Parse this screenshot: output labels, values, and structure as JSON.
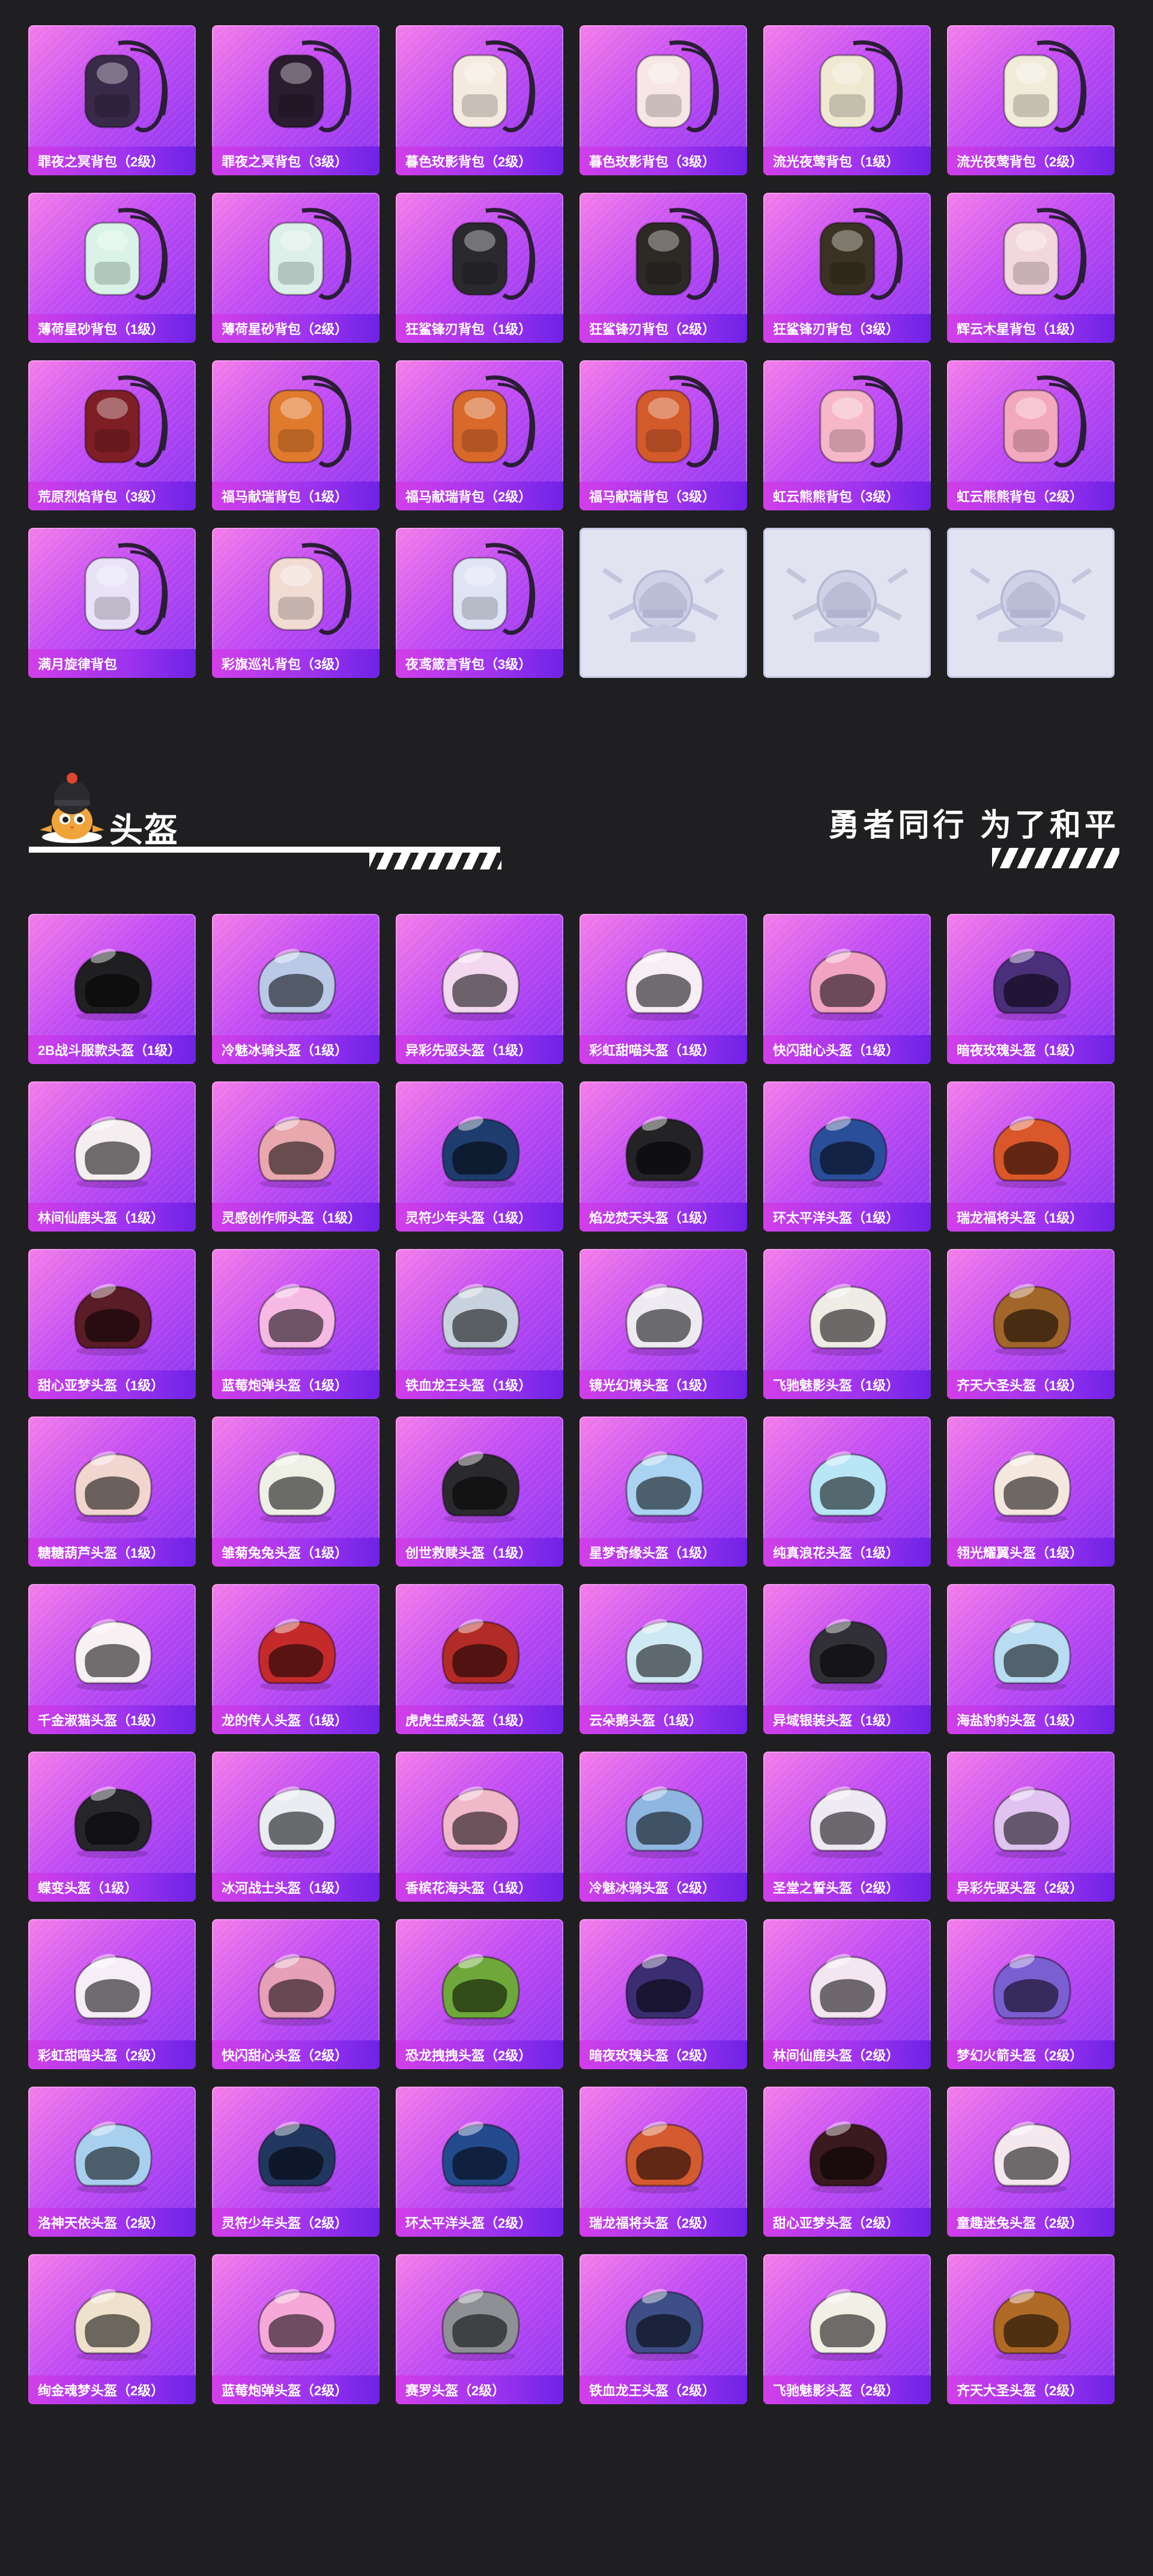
{
  "backpacks": [
    {
      "label": "罪夜之冥背包（2级）",
      "icon": "backpack-icon",
      "color": "#3a2a4a"
    },
    {
      "label": "罪夜之冥背包（3级）",
      "icon": "backpack-icon",
      "color": "#2b1c30"
    },
    {
      "label": "暮色玫影背包（2级）",
      "icon": "backpack-icon",
      "color": "#f4eadf"
    },
    {
      "label": "暮色玫影背包（3级）",
      "icon": "backpack-icon",
      "color": "#f6e6e4"
    },
    {
      "label": "流光夜莺背包（1级）",
      "icon": "backpack-icon",
      "color": "#efe9d2"
    },
    {
      "label": "流光夜莺背包（2级）",
      "icon": "backpack-icon",
      "color": "#f0ecda"
    },
    {
      "label": "薄荷星砂背包（1级）",
      "icon": "backpack-icon",
      "color": "#d9f3e6"
    },
    {
      "label": "薄荷星砂背包（2级）",
      "icon": "backpack-icon",
      "color": "#dcefe8"
    },
    {
      "label": "狂鲨锋刃背包（1级）",
      "icon": "backpack-icon",
      "color": "#2a2a2e"
    },
    {
      "label": "狂鲨锋刃背包（2级）",
      "icon": "backpack-icon",
      "color": "#2b2a25"
    },
    {
      "label": "狂鲨锋刃背包（3级）",
      "icon": "backpack-icon",
      "color": "#3a3222"
    },
    {
      "label": "辉云木星背包（1级）",
      "icon": "backpack-icon",
      "color": "#f3d7de"
    },
    {
      "label": "荒原烈焰背包（3级）",
      "icon": "backpack-icon",
      "color": "#7e1f25"
    },
    {
      "label": "福马献瑞背包（1级）",
      "icon": "backpack-icon",
      "color": "#e07a2d"
    },
    {
      "label": "福马献瑞背包（2级）",
      "icon": "backpack-icon",
      "color": "#d8692b"
    },
    {
      "label": "福马献瑞背包（3级）",
      "icon": "backpack-icon",
      "color": "#d35a2a"
    },
    {
      "label": "虹云熊熊背包（3级）",
      "icon": "backpack-icon",
      "color": "#f6b8c8"
    },
    {
      "label": "虹云熊熊背包（2级）",
      "icon": "backpack-icon",
      "color": "#f3a9bd"
    },
    {
      "label": "满月旋律背包",
      "icon": "backpack-icon",
      "color": "#e9e3f7"
    },
    {
      "label": "彩旗巡礼背包（3级）",
      "icon": "backpack-icon",
      "color": "#f1dcd4"
    },
    {
      "label": "夜鸢箴言背包（3级）",
      "icon": "backpack-icon",
      "color": "#dfe4f5"
    },
    {
      "label": "",
      "icon": "placeholder-emblem-icon",
      "color": "#c9cbe0",
      "placeholder": true
    },
    {
      "label": "",
      "icon": "placeholder-emblem-icon",
      "color": "#c9cbe0",
      "placeholder": true
    },
    {
      "label": "",
      "icon": "placeholder-emblem-icon",
      "color": "#c9cbe0",
      "placeholder": true
    }
  ],
  "section": {
    "title": "头盔",
    "slogan": "勇者同行 为了和平"
  },
  "helmets": [
    {
      "label": "2B战斗服款头盔（1级）",
      "color": "#1f1f22"
    },
    {
      "label": "冷魅冰骑头盔（1级）",
      "color": "#b9c9e6"
    },
    {
      "label": "异彩先驱头盔（1级）",
      "color": "#f2d9ef"
    },
    {
      "label": "彩虹甜喵头盔（1级）",
      "color": "#f7eef5"
    },
    {
      "label": "快闪甜心头盔（1级）",
      "color": "#f1a4c2"
    },
    {
      "label": "暗夜玫瑰头盔（1级）",
      "color": "#4a2f7a"
    },
    {
      "label": "林间仙鹿头盔（1级）",
      "color": "#f4eef1"
    },
    {
      "label": "灵感创作师头盔（1级）",
      "color": "#e8a8ae"
    },
    {
      "label": "灵符少年头盔（1级）",
      "color": "#1f3c6e"
    },
    {
      "label": "焰龙焚天头盔（1级）",
      "color": "#232326"
    },
    {
      "label": "环太平洋头盔（1级）",
      "color": "#2a4e9a"
    },
    {
      "label": "瑞龙福将头盔（1级）",
      "color": "#d9572a"
    },
    {
      "label": "甜心亚梦头盔（1级）",
      "color": "#5a1c26"
    },
    {
      "label": "蓝莓炮弹头盔（1级）",
      "color": "#f6b9e4"
    },
    {
      "label": "铁血龙王头盔（1级）",
      "color": "#c8d2de"
    },
    {
      "label": "镜光幻境头盔（1级）",
      "color": "#eeeaf2"
    },
    {
      "label": "飞驰魅影头盔（1级）",
      "color": "#efece6"
    },
    {
      "label": "齐天大圣头盔（1级）",
      "color": "#a2652a"
    },
    {
      "label": "糖糖葫芦头盔（1级）",
      "color": "#f0d6cf"
    },
    {
      "label": "雏菊兔兔头盔（1级）",
      "color": "#eef0e6"
    },
    {
      "label": "创世救赎头盔（1级）",
      "color": "#2a2a2e"
    },
    {
      "label": "星梦奇缘头盔（1级）",
      "color": "#a9d3f1"
    },
    {
      "label": "纯真浪花头盔（1级）",
      "color": "#b9e6f6"
    },
    {
      "label": "翎光耀翼头盔（1级）",
      "color": "#f4e7de"
    },
    {
      "label": "千金淑猫头盔（1级）",
      "color": "#f8f1f4"
    },
    {
      "label": "龙的传人头盔（1级）",
      "color": "#c52a2a"
    },
    {
      "label": "虎虎生威头盔（1级）",
      "color": "#b32b26"
    },
    {
      "label": "云朵鹅头盔（1级）",
      "color": "#cfe9f4"
    },
    {
      "label": "异域银装头盔（1级）",
      "color": "#303036"
    },
    {
      "label": "海盐豹豹头盔（1级）",
      "color": "#b8dcf2"
    },
    {
      "label": "蝶变头盔（1级）",
      "color": "#26262a"
    },
    {
      "label": "冰河战士头盔（1级）",
      "color": "#e9ecf1"
    },
    {
      "label": "香槟花海头盔（1级）",
      "color": "#f1b8c9"
    },
    {
      "label": "冷魅冰骑头盔（2级）",
      "color": "#8fb6e1"
    },
    {
      "label": "圣堂之誓头盔（2级）",
      "color": "#efe9f3"
    },
    {
      "label": "异彩先驱头盔（2级）",
      "color": "#e1c3f1"
    },
    {
      "label": "彩虹甜喵头盔（2级）",
      "color": "#f6eef7"
    },
    {
      "label": "快闪甜心头盔（2级）",
      "color": "#e6a0b8"
    },
    {
      "label": "恐龙拽拽头盔（2级）",
      "color": "#6fa83a"
    },
    {
      "label": "暗夜玫瑰头盔（2级）",
      "color": "#3b2d72"
    },
    {
      "label": "林间仙鹿头盔（2级）",
      "color": "#f3e6f0"
    },
    {
      "label": "梦幻火箭头盔（2级）",
      "color": "#7a5fd0"
    },
    {
      "label": "洛神天依头盔（2级）",
      "color": "#a8d0ee"
    },
    {
      "label": "灵符少年头盔（2级）",
      "color": "#22375f"
    },
    {
      "label": "环太平洋头盔（2级）",
      "color": "#244a8e"
    },
    {
      "label": "瑞龙福将头盔（2级）",
      "color": "#d45a2f"
    },
    {
      "label": "甜心亚梦头盔（2级）",
      "color": "#3a1a1e"
    },
    {
      "label": "童趣迷兔头盔（2级）",
      "color": "#f4e8ee"
    },
    {
      "label": "绚金魂梦头盔（2级）",
      "color": "#efe2cc"
    },
    {
      "label": "蓝莓炮弹头盔（2级）",
      "color": "#f6a9d8"
    },
    {
      "label": "赛罗头盔（2级）",
      "color": "#8f9096"
    },
    {
      "label": "铁血龙王头盔（2级）",
      "color": "#3d4f86"
    },
    {
      "label": "飞驰魅影头盔（2级）",
      "color": "#f2efe6"
    },
    {
      "label": "齐天大圣头盔（2级）",
      "color": "#b06a26"
    }
  ]
}
